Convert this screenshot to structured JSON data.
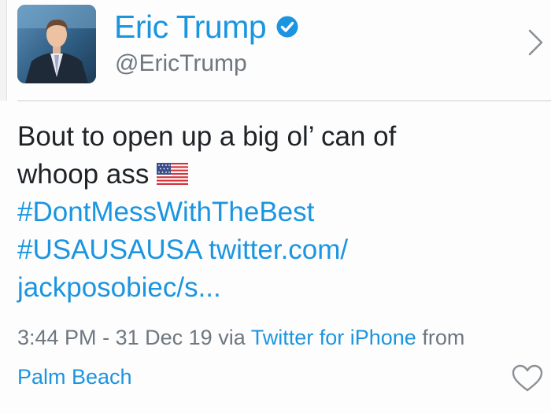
{
  "profile": {
    "display_name": "Eric Trump",
    "handle": "@EricTrump",
    "verified": true,
    "avatar_icon": "profile-photo"
  },
  "tweet": {
    "line1": "Bout to open up a big ol’ can of",
    "line2": "whoop ass",
    "flag_icon": "us-flag-emoji",
    "hashtag1": "#DontMessWithTheBest",
    "hashtag2": "#USAUSAUSA",
    "link_part1": "twitter.com/",
    "link_part2": "jackposobiec/s..."
  },
  "meta": {
    "time": "3:44 PM",
    "separator": "-",
    "date": "31 Dec 19",
    "via_label": "via",
    "client": "Twitter for iPhone",
    "from_label": "from",
    "location": "Palm Beach"
  },
  "icons": {
    "verified": "verified-badge-icon",
    "chevron": "chevron-right-icon",
    "like": "heart-icon"
  },
  "colors": {
    "accent": "#1b95e0",
    "text": "#1f2327",
    "secondary": "#6e7780",
    "divider": "#e3e6e8"
  }
}
